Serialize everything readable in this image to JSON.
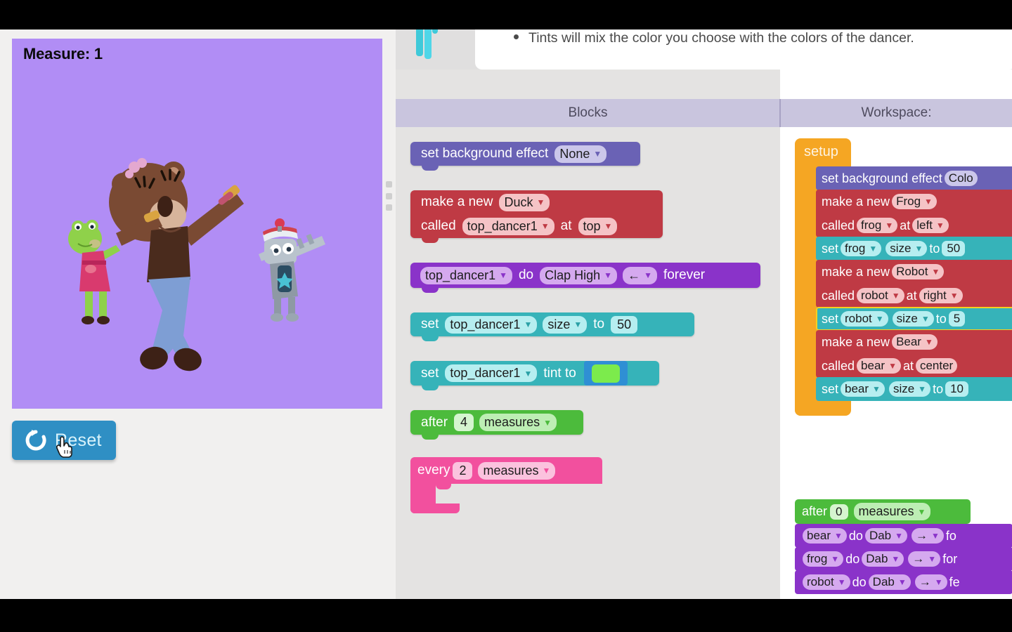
{
  "stage": {
    "measure_label": "Measure: 1",
    "background_color": "#b18df5",
    "dancers": [
      "bear",
      "frog",
      "robot"
    ]
  },
  "reset_button": {
    "label": "Reset",
    "icon": "refresh-icon",
    "color": "#2f8fc4"
  },
  "tutorial": {
    "bullet": "Tints will mix the color you choose with the colors of the dancer."
  },
  "headers": {
    "blocks": "Blocks",
    "workspace": "Workspace:"
  },
  "palette": {
    "blocks": [
      {
        "id": "set-background-effect",
        "color": "#6a62b5",
        "parts": [
          {
            "type": "label",
            "text": "set background effect"
          },
          {
            "type": "field",
            "text": "None"
          }
        ]
      },
      {
        "id": "make-a-new-duck",
        "color": "#bf3a44",
        "row1": [
          {
            "type": "label",
            "text": "make a new"
          },
          {
            "type": "field",
            "text": "Duck"
          }
        ],
        "row2": [
          {
            "type": "label",
            "text": "called"
          },
          {
            "type": "field",
            "text": "top_dancer1"
          },
          {
            "type": "label",
            "text": "at"
          },
          {
            "type": "field",
            "text": "top"
          }
        ]
      },
      {
        "id": "dancer-do-move-forever",
        "color": "#8a33c9",
        "parts": [
          {
            "type": "field",
            "text": "top_dancer1"
          },
          {
            "type": "label",
            "text": "do"
          },
          {
            "type": "field",
            "text": "Clap High"
          },
          {
            "type": "field",
            "text": "←"
          },
          {
            "type": "label",
            "text": "forever"
          }
        ]
      },
      {
        "id": "set-dancer-size",
        "color": "#36b3b9",
        "parts": [
          {
            "type": "label",
            "text": "set"
          },
          {
            "type": "field",
            "text": "top_dancer1"
          },
          {
            "type": "field",
            "text": "size"
          },
          {
            "type": "label",
            "text": "to"
          },
          {
            "type": "num",
            "text": "50"
          }
        ]
      },
      {
        "id": "set-dancer-tint",
        "color": "#36b3b9",
        "parts": [
          {
            "type": "label",
            "text": "set"
          },
          {
            "type": "field",
            "text": "top_dancer1"
          },
          {
            "type": "label",
            "text": "tint to"
          },
          {
            "type": "swatch",
            "color": "#7ceb4c"
          }
        ]
      },
      {
        "id": "after-n-measures",
        "color": "#4cbb3c",
        "parts": [
          {
            "type": "label",
            "text": "after"
          },
          {
            "type": "num",
            "text": "4"
          },
          {
            "type": "field",
            "text": "measures"
          }
        ]
      },
      {
        "id": "every-n-measures",
        "color": "#f2509e",
        "parts": [
          {
            "type": "label",
            "text": "every"
          },
          {
            "type": "num",
            "text": "2"
          },
          {
            "type": "field",
            "text": "measures"
          }
        ]
      }
    ]
  },
  "workspace": {
    "setup": {
      "label": "setup",
      "color": "#f5a623",
      "children": [
        {
          "id": "ws-set-background-effect",
          "color": "#6a62b5",
          "parts": [
            {
              "type": "label",
              "text": "set background effect"
            },
            {
              "type": "field",
              "text": "Colo"
            }
          ]
        },
        {
          "id": "ws-make-a-new-frog",
          "color": "#bf3a44",
          "row1": [
            {
              "type": "label",
              "text": "make a new"
            },
            {
              "type": "field",
              "text": "Frog"
            }
          ],
          "row2": [
            {
              "type": "label",
              "text": "called"
            },
            {
              "type": "field",
              "text": "frog"
            },
            {
              "type": "label",
              "text": "at"
            },
            {
              "type": "field",
              "text": "left"
            }
          ]
        },
        {
          "id": "ws-set-frog-size",
          "color": "#36b3b9",
          "parts": [
            {
              "type": "label",
              "text": "set"
            },
            {
              "type": "field",
              "text": "frog"
            },
            {
              "type": "field",
              "text": "size"
            },
            {
              "type": "label",
              "text": "to"
            },
            {
              "type": "num",
              "text": "50"
            }
          ]
        },
        {
          "id": "ws-make-a-new-robot",
          "color": "#bf3a44",
          "row1": [
            {
              "type": "label",
              "text": "make a new"
            },
            {
              "type": "field",
              "text": "Robot"
            }
          ],
          "row2": [
            {
              "type": "label",
              "text": "called"
            },
            {
              "type": "field",
              "text": "robot"
            },
            {
              "type": "label",
              "text": "at"
            },
            {
              "type": "field",
              "text": "right"
            }
          ]
        },
        {
          "id": "ws-set-robot-size",
          "color": "#36b3b9",
          "highlighted": true,
          "parts": [
            {
              "type": "label",
              "text": "set"
            },
            {
              "type": "field",
              "text": "robot"
            },
            {
              "type": "field",
              "text": "size"
            },
            {
              "type": "label",
              "text": "to"
            },
            {
              "type": "num",
              "text": "5"
            }
          ]
        },
        {
          "id": "ws-make-a-new-bear",
          "color": "#bf3a44",
          "row1": [
            {
              "type": "label",
              "text": "make a new"
            },
            {
              "type": "field",
              "text": "Bear"
            }
          ],
          "row2": [
            {
              "type": "label",
              "text": "called"
            },
            {
              "type": "field",
              "text": "bear"
            },
            {
              "type": "label",
              "text": "at"
            },
            {
              "type": "field",
              "text": "center"
            }
          ]
        },
        {
          "id": "ws-set-bear-size",
          "color": "#36b3b9",
          "parts": [
            {
              "type": "label",
              "text": "set"
            },
            {
              "type": "field",
              "text": "bear"
            },
            {
              "type": "field",
              "text": "size"
            },
            {
              "type": "label",
              "text": "to"
            },
            {
              "type": "num",
              "text": "10"
            }
          ]
        }
      ]
    },
    "after_stack": {
      "header": {
        "id": "ws-after-0-measures",
        "color": "#4cbb3c",
        "parts": [
          {
            "type": "label",
            "text": "after"
          },
          {
            "type": "num",
            "text": "0"
          },
          {
            "type": "field",
            "text": "measures"
          }
        ]
      },
      "rows": [
        {
          "id": "ws-bear-dab",
          "dancer": "bear",
          "do": "do",
          "move": "Dab",
          "dir": "→",
          "tail": "fo"
        },
        {
          "id": "ws-frog-dab",
          "dancer": "frog",
          "do": "do",
          "move": "Dab",
          "dir": "→",
          "tail": "for"
        },
        {
          "id": "ws-robot-dab",
          "dancer": "robot",
          "do": "do",
          "move": "Dab",
          "dir": "→",
          "tail": "fe"
        }
      ]
    }
  }
}
